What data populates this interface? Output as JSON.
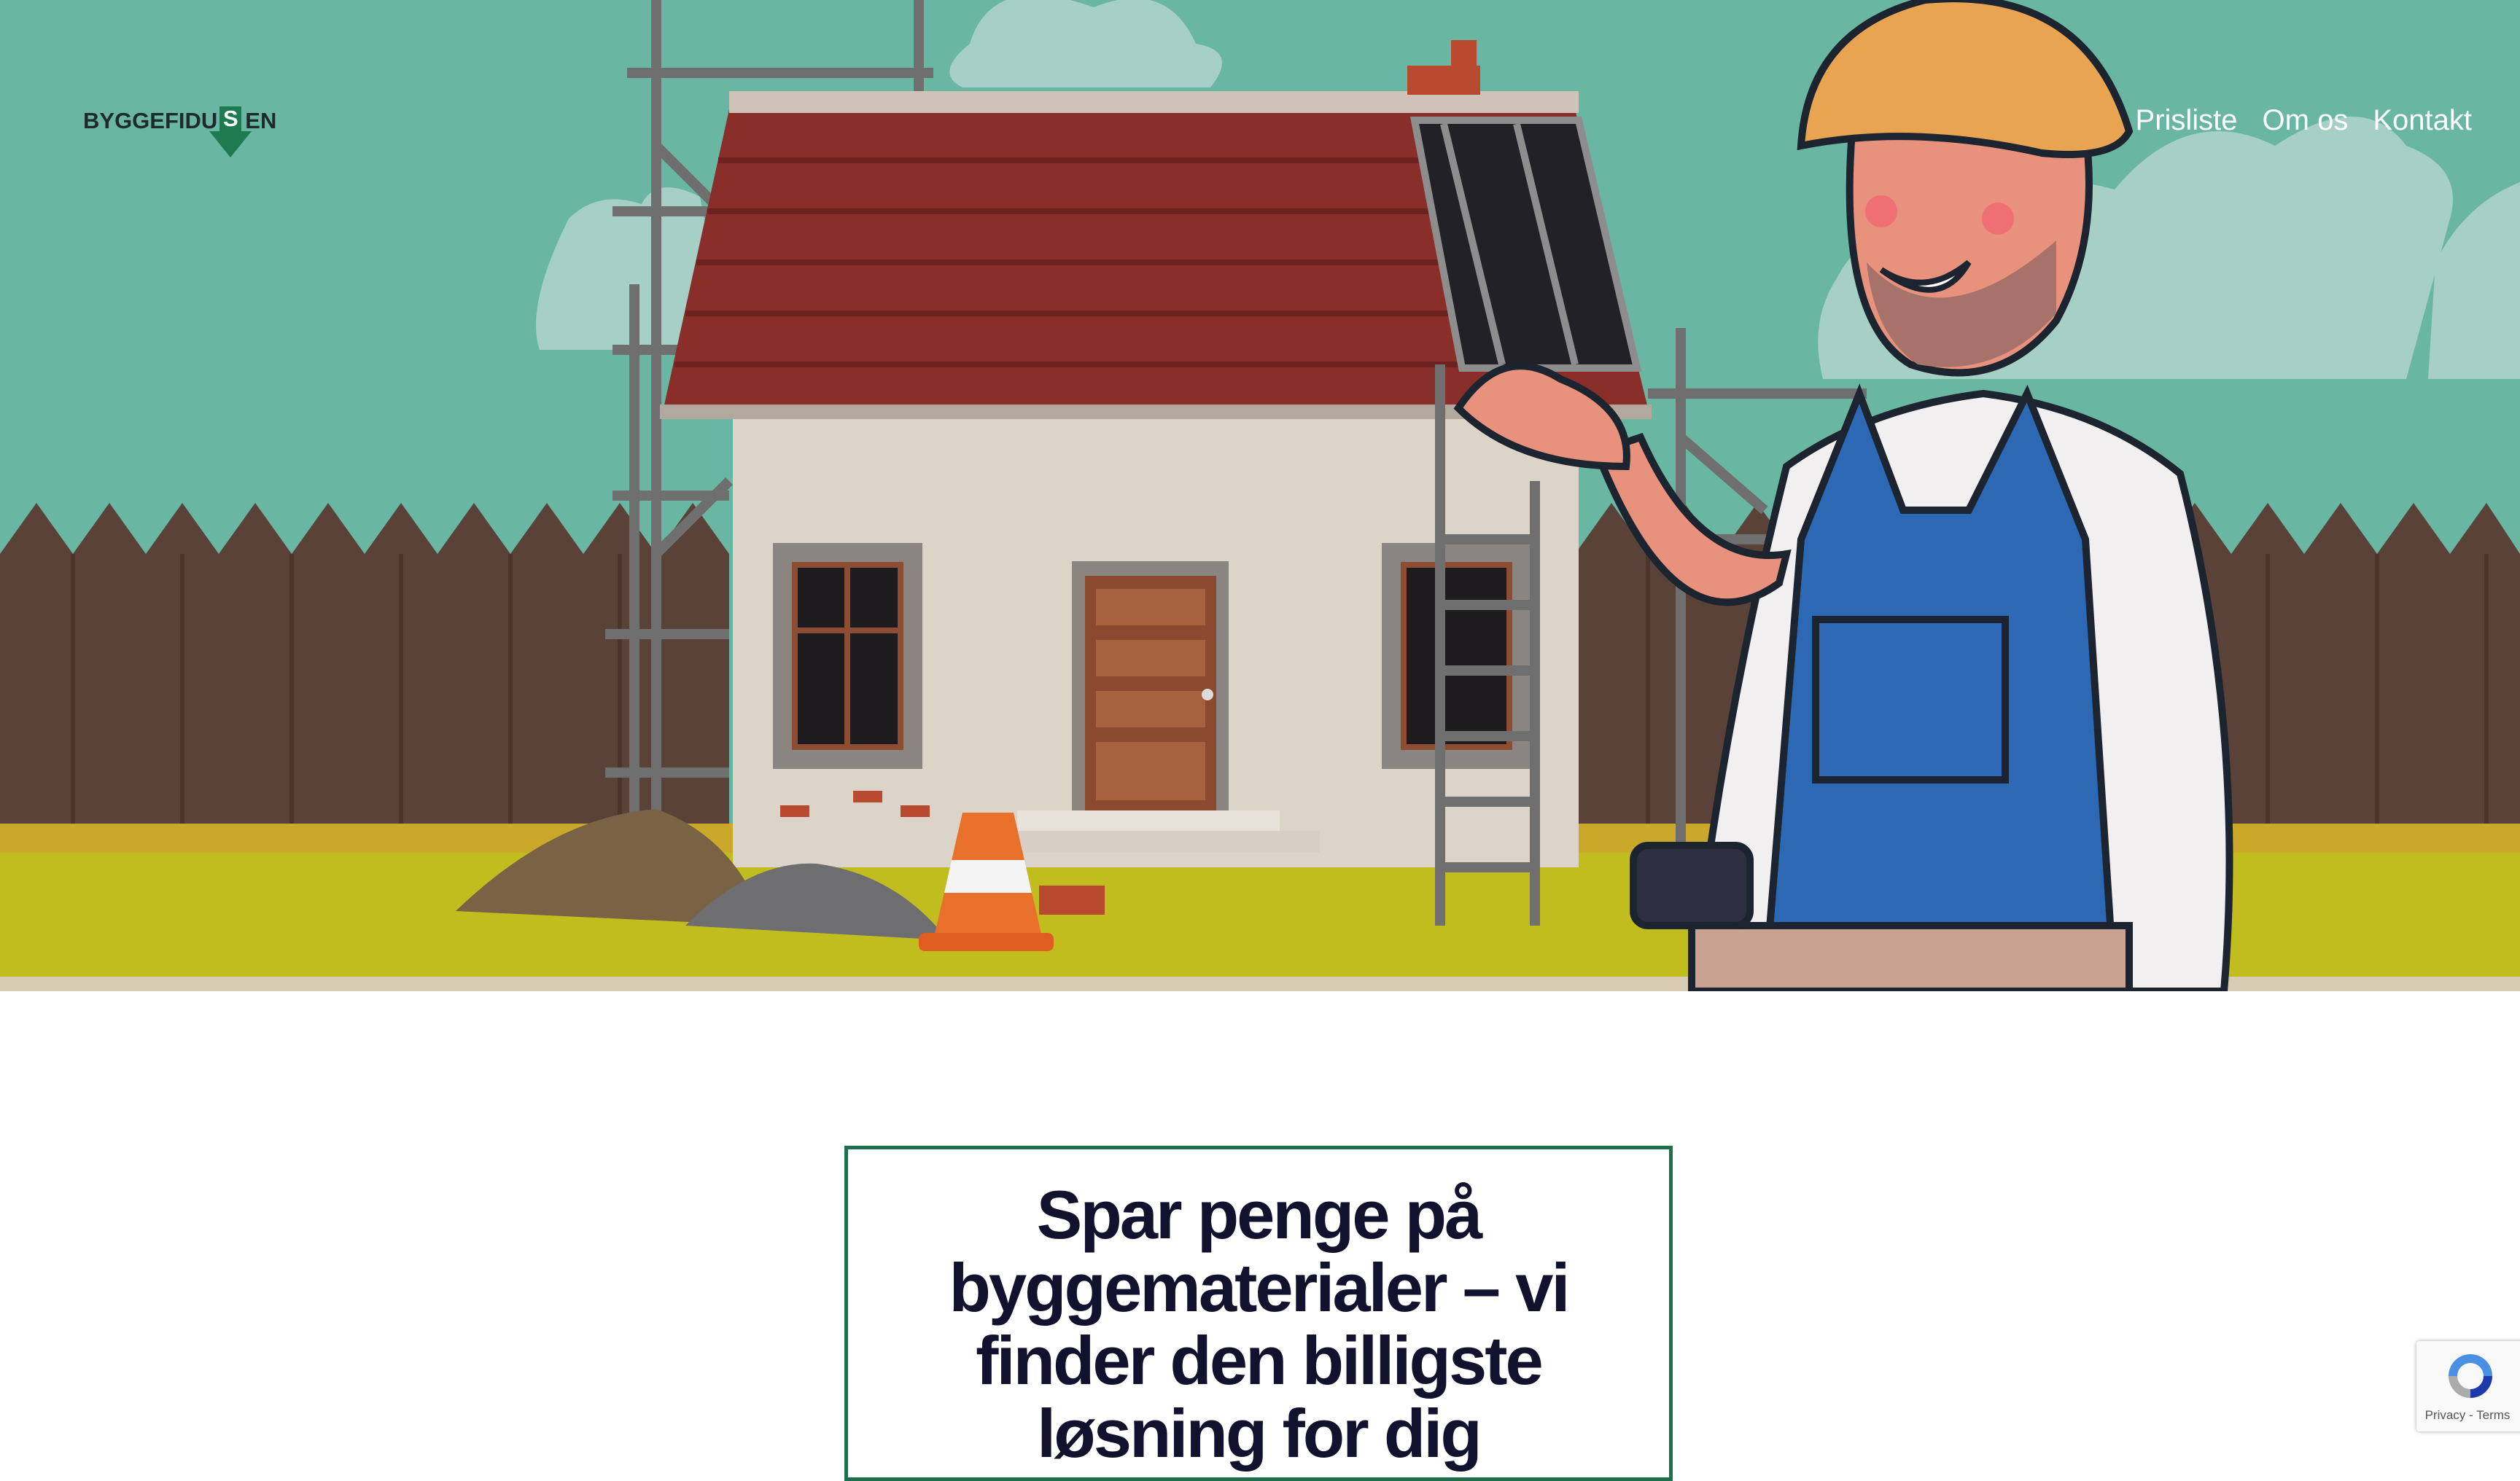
{
  "header": {
    "logo": {
      "prefix": "BYGGEFIDU",
      "mark_letter": "S",
      "suffix": "EN"
    },
    "nav": [
      {
        "label": "Prisliste"
      },
      {
        "label": "Om os"
      },
      {
        "label": "Kontakt"
      }
    ]
  },
  "hero": {
    "illustration": "construction-worker-house-illustration",
    "colors": {
      "sky": "#69b7a2",
      "fence": "#5a4238",
      "ground": "#c2bd1f",
      "roof": "#8a2e2a"
    }
  },
  "main": {
    "headline_lines": [
      "Spar penge på",
      "byggematerialer – vi",
      "finder den billigste",
      "løsning for dig"
    ]
  },
  "recaptcha": {
    "privacy": "Privacy",
    "separator": " - ",
    "terms": "Terms",
    "icon": "recaptcha-icon"
  },
  "colors": {
    "accent": "#1f6e4e",
    "headline": "#12122e"
  }
}
